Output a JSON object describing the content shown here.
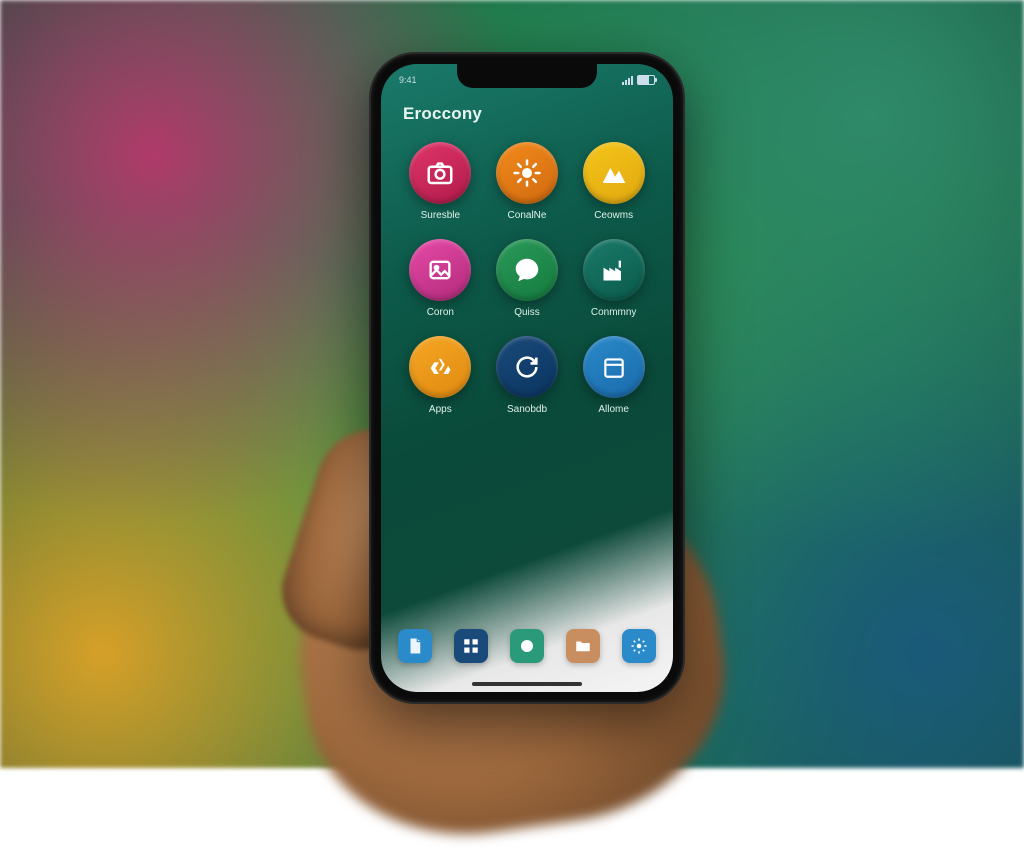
{
  "status": {
    "time": "9:41"
  },
  "header": {
    "title": "Eroccony"
  },
  "apps": [
    {
      "label": "Suresble",
      "color": "linear-gradient(150deg,#e0356a,#b01a4a)",
      "icon": "camera-icon"
    },
    {
      "label": "ConalNe",
      "color": "linear-gradient(150deg,#f28a1a,#d06a10)",
      "icon": "sun-icon"
    },
    {
      "label": "Ceowms",
      "color": "linear-gradient(150deg,#f5c518,#e0a810)",
      "icon": "mountain-icon"
    },
    {
      "label": "Coron",
      "color": "linear-gradient(150deg,#e84aa8,#b02a7a)",
      "icon": "photo-icon"
    },
    {
      "label": "Quiss",
      "color": "linear-gradient(150deg,#2a9a5a,#147a3e)",
      "icon": "chat-icon"
    },
    {
      "label": "Conmmny",
      "color": "linear-gradient(150deg,#1a7a6a,#0a5a4a)",
      "icon": "factory-icon"
    },
    {
      "label": "Apps",
      "color": "linear-gradient(150deg,#f5a623,#e08a10)",
      "icon": "recycle-icon"
    },
    {
      "label": "Sanobdb",
      "color": "linear-gradient(150deg,#1a4a7a,#0a3460)",
      "icon": "refresh-icon"
    },
    {
      "label": "Allome",
      "color": "linear-gradient(150deg,#2a8aca,#1a6aaa)",
      "icon": "calendar-icon"
    }
  ],
  "dock": [
    {
      "color": "#2a8aca",
      "icon": "doc-icon"
    },
    {
      "color": "#1a4a7a",
      "icon": "grid-icon"
    },
    {
      "color": "#2a9a7a",
      "icon": "app-icon"
    },
    {
      "color": "#c98e5f",
      "icon": "folder-icon"
    },
    {
      "color": "#2a8aca",
      "icon": "settings-icon"
    }
  ]
}
